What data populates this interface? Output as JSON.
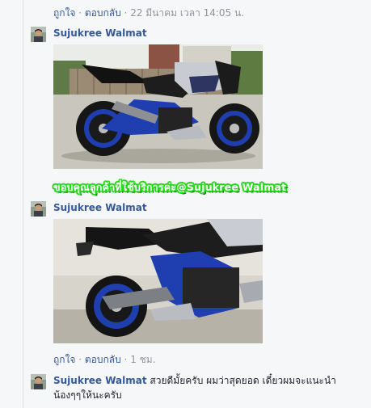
{
  "top_actions": {
    "like": "ถูกใจ",
    "sep1": " · ",
    "reply": "ตอบกลับ",
    "sep2": " · ",
    "timestamp": "22 มีนาคม เวลา 14:05 น."
  },
  "post1": {
    "author": "Sujukree Walmat"
  },
  "post2": {
    "author": "Sujukree Walmat",
    "sticker_text": "ขอบคุณลูกค้าที่ใช้บริการค่ะ@Sujukree Walmat"
  },
  "mid_actions": {
    "like": "ถูกใจ",
    "sep1": " · ",
    "reply": "ตอบกลับ",
    "sep2": " · ",
    "timestamp": "1 ชม."
  },
  "comment": {
    "author": "Sujukree Walmat",
    "text_line1": "สวยดีมั้ยครับ ผมว่าสุดยอด เดี๋ยวผมจะแนะนำ",
    "text_line2": "น้องๆๆให้นะครับ"
  },
  "colors": {
    "link": "#365899",
    "meta": "#90949c",
    "sticker_outline": "#26d81b",
    "bike_blue": "#1f3fb0"
  }
}
